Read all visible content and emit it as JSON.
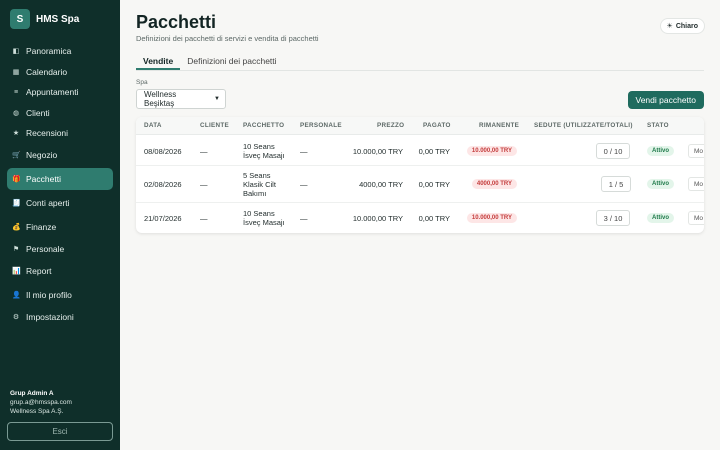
{
  "brand": {
    "logo_letter": "S",
    "name": "HMS Spa"
  },
  "nav": [
    {
      "icon": "grid-icon",
      "glyph": "◧",
      "label": "Panoramica"
    },
    {
      "icon": "calendar-icon",
      "glyph": "▦",
      "label": "Calendario"
    },
    {
      "icon": "list-icon",
      "glyph": "≡",
      "label": "Appuntamenti"
    },
    {
      "icon": "clients-icon",
      "glyph": "◍",
      "label": "Clienti"
    },
    {
      "icon": "star-icon",
      "glyph": "★",
      "label": "Recensioni"
    },
    {
      "icon": "cart-icon",
      "glyph": "🛒",
      "label": "Negozio"
    },
    {
      "icon": "gift-icon",
      "glyph": "🎁",
      "label": "Pacchetti",
      "active": true
    },
    {
      "icon": "receipt-icon",
      "glyph": "🧾",
      "label": "Conti aperti"
    },
    {
      "icon": "money-bag-icon",
      "glyph": "💰",
      "label": "Finanze"
    },
    {
      "icon": "flag-icon",
      "glyph": "⚑",
      "label": "Personale"
    },
    {
      "icon": "chart-icon",
      "glyph": "📊",
      "label": "Report"
    },
    {
      "icon": "user-icon",
      "glyph": "👤",
      "label": "Il mio profilo"
    },
    {
      "icon": "gear-icon",
      "glyph": "⚙",
      "label": "Impostazioni"
    }
  ],
  "user": {
    "name": "Grup Admin A",
    "email": "grup.a@hmsspa.com",
    "company": "Wellness Spa A.Ş."
  },
  "logout_label": "Esci",
  "page": {
    "title": "Pacchetti",
    "subtitle": "Definizioni dei pacchetti di servizi e vendita di pacchetti",
    "theme_label": "Chiaro"
  },
  "tabs": [
    "Vendite",
    "Definizioni dei pacchetti"
  ],
  "filter": {
    "label": "Spa",
    "value": "Wellness Beşiktaş"
  },
  "primary_button": "Vendi pacchetto",
  "table": {
    "headers": [
      "DATA",
      "CLIENTE",
      "PACCHETTO",
      "PERSONALE",
      "PREZZO",
      "PAGATO",
      "RIMANENTE",
      "SEDUTE (UTILIZZATE/TOTALI)",
      "STATO"
    ],
    "rows": [
      {
        "date": "08/08/2026",
        "client": "—",
        "package": "10 Seans İsveç Masajı",
        "staff": "—",
        "price": "10.000,00 TRY",
        "paid": "0,00 TRY",
        "remaining": "10.000,00 TRY",
        "sessions": "0 / 10",
        "status": "Attivo",
        "action": "Mo"
      },
      {
        "date": "02/08/2026",
        "client": "—",
        "package": "5 Seans Klasik Cilt Bakımı",
        "staff": "—",
        "price": "4000,00 TRY",
        "paid": "0,00 TRY",
        "remaining": "4000,00 TRY",
        "sessions": "1 / 5",
        "status": "Attivo",
        "action": "Mo"
      },
      {
        "date": "21/07/2026",
        "client": "—",
        "package": "10 Seans İsveç Masajı",
        "staff": "—",
        "price": "10.000,00 TRY",
        "paid": "0,00 TRY",
        "remaining": "10.000,00 TRY",
        "sessions": "3 / 10",
        "status": "Attivo",
        "action": "Mo"
      }
    ]
  },
  "colors": {
    "sidebar": "#0f2f2a",
    "accent": "#2f7c6f",
    "primary": "#1f6b5e"
  }
}
